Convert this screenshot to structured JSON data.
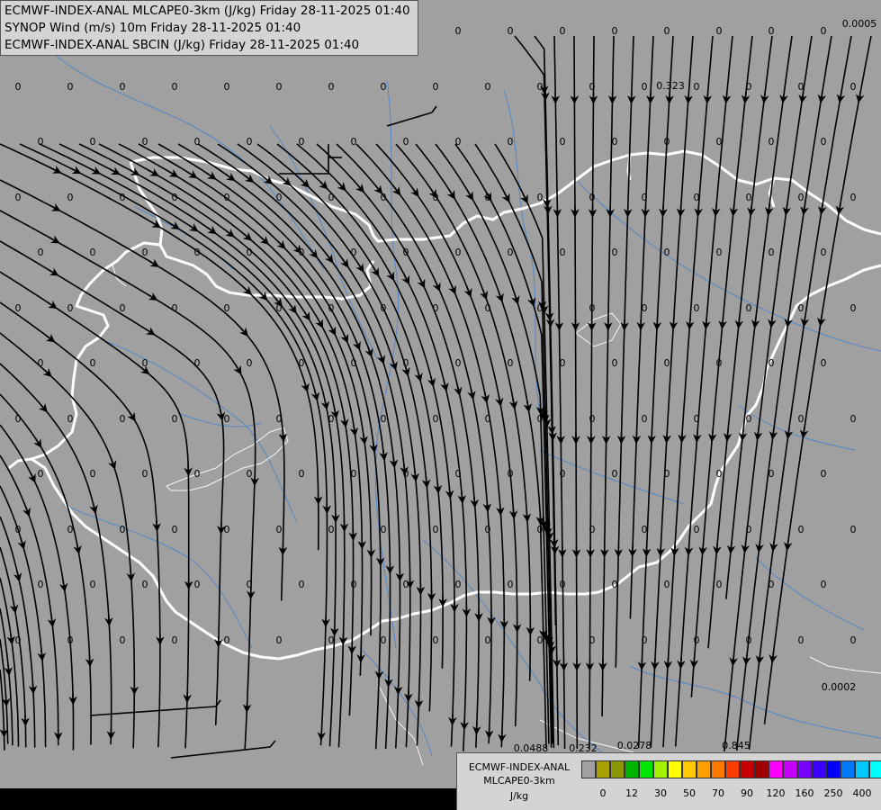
{
  "titles": {
    "line1": "ECMWF-INDEX-ANAL MLCAPE0-3km (J/kg) Friday 28-11-2025 01:40",
    "line2": "SYNOP Wind (m/s) 10m Friday 28-11-2025 01:40",
    "line3": "ECMWF-INDEX-ANAL SBCIN (J/kg) Friday 28-11-2025 01:40"
  },
  "legend": {
    "title_line1": "ECMWF-INDEX-ANAL",
    "title_line2": "MLCAPE0-3km",
    "units": "J/kg",
    "colors": [
      "#a0a0a0",
      "#a8a000",
      "#8c9600",
      "#00b400",
      "#00e600",
      "#a0f000",
      "#ffff00",
      "#ffc800",
      "#ffa000",
      "#ff7800",
      "#ff3c00",
      "#c80000",
      "#a00000",
      "#ff00ff",
      "#c800ff",
      "#7800ff",
      "#3c00ff",
      "#0000ff",
      "#0078ff",
      "#00c8ff",
      "#00ffff",
      "#96ffff",
      "#ffffff"
    ],
    "ticks": [
      "0",
      "12",
      "30",
      "50",
      "70",
      "90",
      "120",
      "160",
      "250",
      "400"
    ]
  },
  "colors": {
    "border": "#ffffff",
    "river": "#3c7fd0",
    "streamline": "#000000"
  },
  "value_labels": [
    "0",
    "0.0005",
    "0.323",
    "0.0488",
    "0.232",
    "0.0278",
    "0.845",
    "0.0002"
  ]
}
